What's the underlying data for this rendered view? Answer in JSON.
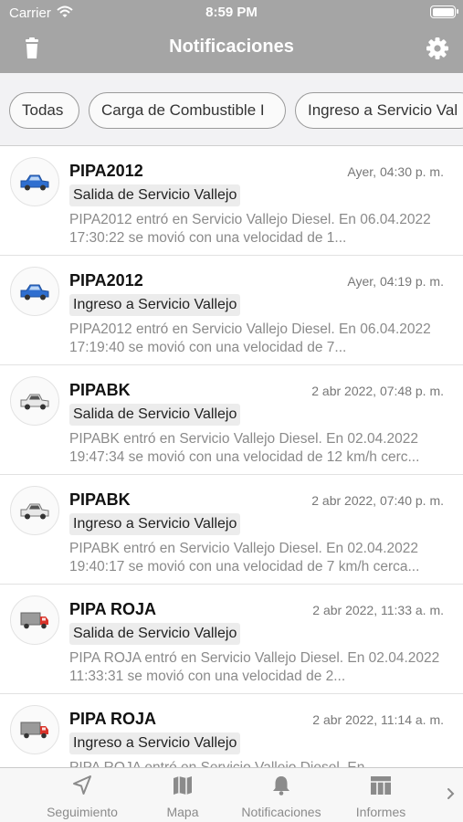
{
  "status_bar": {
    "carrier": "Carrier",
    "time": "8:59 PM"
  },
  "header": {
    "title": "Notificaciones",
    "left_icon": "trash-icon",
    "right_icon": "gear-icon"
  },
  "filters": [
    {
      "label": "Todas"
    },
    {
      "label": "Carga de Combustible I"
    },
    {
      "label": "Ingreso a Servicio Val"
    }
  ],
  "notifications": [
    {
      "vehicle": "PIPA2012",
      "date": "Ayer, 04:30 p. m.",
      "event": "Salida de Servicio Vallejo",
      "message": "PIPA2012 entró en Servicio Vallejo Diesel. En 06.04.2022 17:30:22 se movió con una velocidad de 1...",
      "icon": "blue-pickup",
      "icon_color": "#2f6fd0"
    },
    {
      "vehicle": "PIPA2012",
      "date": "Ayer, 04:19 p. m.",
      "event": "Ingreso a Servicio Vallejo",
      "message": "PIPA2012 entró en Servicio Vallejo Diesel. En 06.04.2022 17:19:40 se movió con una velocidad de 7...",
      "icon": "blue-pickup",
      "icon_color": "#2f6fd0"
    },
    {
      "vehicle": "PIPABK",
      "date": "2 abr 2022, 07:48 p. m.",
      "event": "Salida de Servicio Vallejo",
      "message": "PIPABK entró en Servicio Vallejo Diesel. En 02.04.2022 19:47:34 se movió con una velocidad de 12 km/h cerc...",
      "icon": "white-pickup",
      "icon_color": "#e8e8e8"
    },
    {
      "vehicle": "PIPABK",
      "date": "2 abr 2022, 07:40 p. m.",
      "event": "Ingreso a Servicio Vallejo",
      "message": "PIPABK entró en Servicio Vallejo Diesel. En 02.04.2022 19:40:17 se movió con una velocidad de 7 km/h cerca...",
      "icon": "white-pickup",
      "icon_color": "#e8e8e8"
    },
    {
      "vehicle": "PIPA ROJA",
      "date": "2 abr 2022, 11:33 a. m.",
      "event": "Salida de Servicio Vallejo",
      "message": "PIPA ROJA entró en Servicio Vallejo Diesel. En 02.04.2022 11:33:31 se movió con una velocidad de 2...",
      "icon": "red-truck",
      "icon_color": "#d9342b"
    },
    {
      "vehicle": "PIPA ROJA",
      "date": "2 abr 2022, 11:14 a. m.",
      "event": "Ingreso a Servicio Vallejo",
      "message": "PIPA ROJA entró en Servicio Vallejo Diesel. En",
      "icon": "red-truck",
      "icon_color": "#d9342b"
    }
  ],
  "tabbar": {
    "tabs": [
      {
        "label": "Seguimiento",
        "icon": "location-arrow-icon"
      },
      {
        "label": "Mapa",
        "icon": "map-icon"
      },
      {
        "label": "Notificaciones",
        "icon": "bell-icon"
      },
      {
        "label": "Informes",
        "icon": "table-icon"
      }
    ],
    "more_icon": "chevron-right-icon"
  },
  "colors": {
    "header_bg": "#a5a5a5",
    "tab_gray": "#8b8b8b",
    "filter_bg": "#f2f2f4"
  }
}
